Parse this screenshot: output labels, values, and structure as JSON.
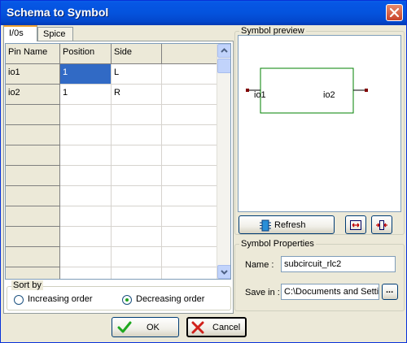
{
  "window": {
    "title": "Schema to Symbol"
  },
  "tabs": [
    {
      "label": "I/0s"
    },
    {
      "label": "Spice"
    }
  ],
  "grid": {
    "headers": [
      "Pin Name",
      "Position",
      "Side"
    ],
    "rows": [
      [
        "io1",
        "1",
        "L"
      ],
      [
        "io2",
        "1",
        "R"
      ]
    ],
    "selected_cell": "row 1, Position"
  },
  "sort_by": {
    "label": "Sort by",
    "options": [
      {
        "label": "Increasing order",
        "checked": false
      },
      {
        "label": "Decreasing order",
        "checked": true
      }
    ]
  },
  "symbol_preview": {
    "label": "Symbol preview",
    "pins": [
      {
        "label": "io1"
      },
      {
        "label": "io2"
      }
    ],
    "body_color": "#008000",
    "pin_color": "#800000",
    "refresh_label": "Refresh"
  },
  "symbol_properties": {
    "label": "Symbol Properties",
    "name_label": "Name :",
    "name_value": "subcircuit_rlc2",
    "save_label": "Save in :",
    "save_value": "C:\\Documents and Setti",
    "browse_label": "..."
  },
  "footer": {
    "ok_label": "OK",
    "cancel_label": "Cancel"
  },
  "colors": {
    "titlebar": "#0453dd",
    "selection": "#316ac5",
    "ok_check": "#1fa81f",
    "cancel_x": "#d0201a"
  }
}
